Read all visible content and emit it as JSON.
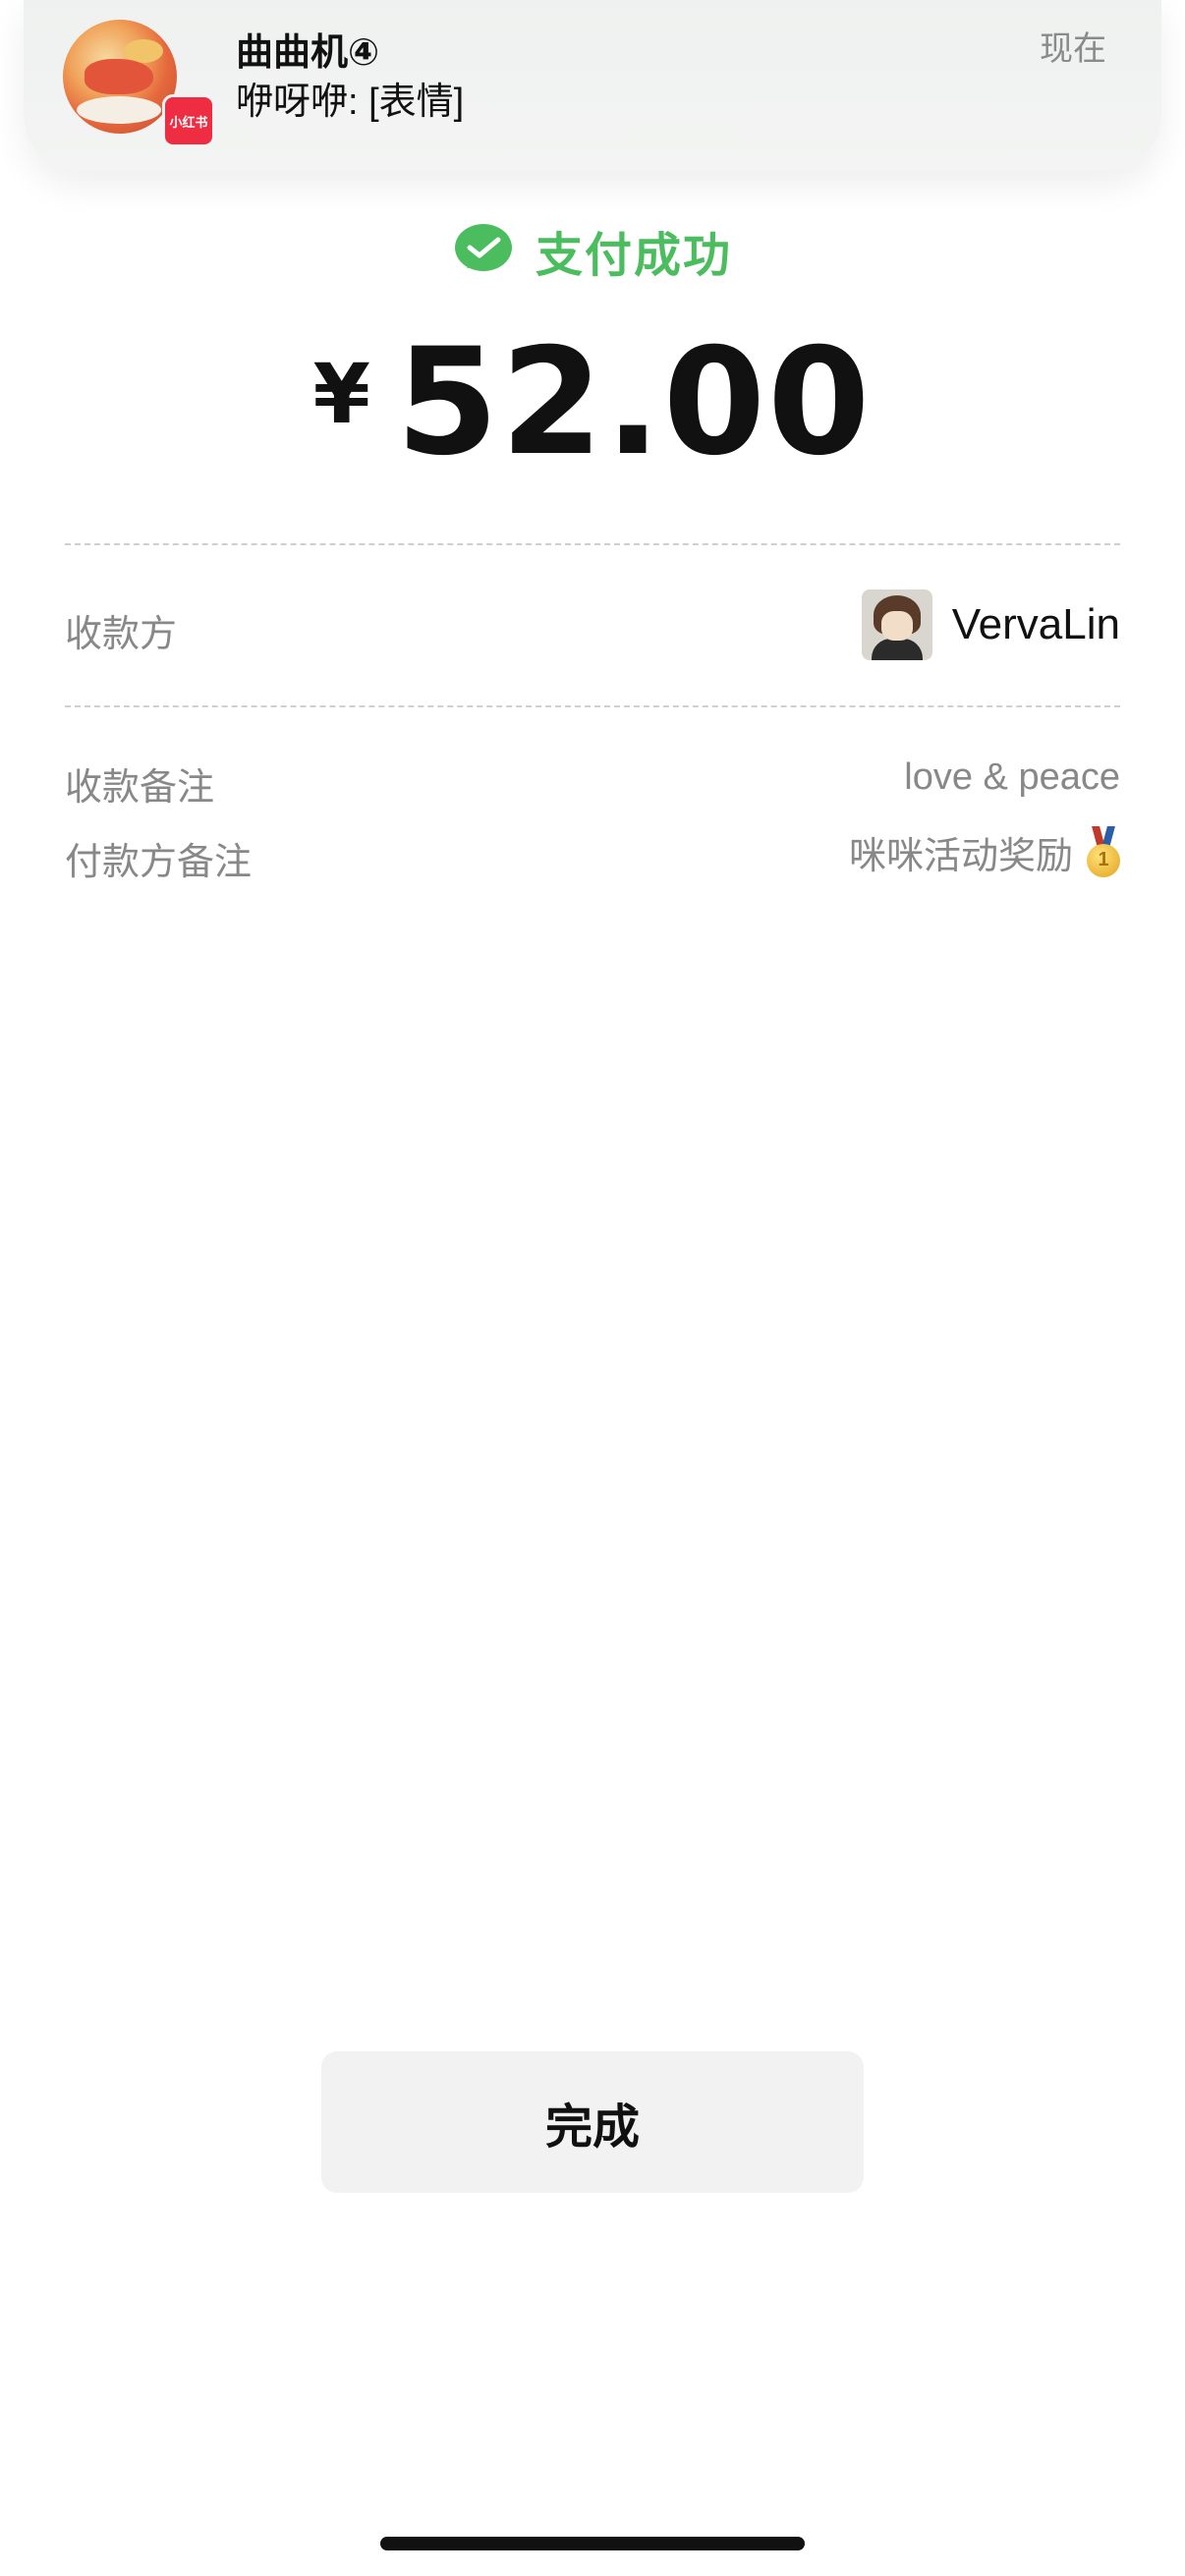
{
  "notification": {
    "title": "曲曲机④",
    "body": "咿呀咿: [表情]",
    "time": "现在",
    "app_badge": "小红书",
    "app_badge_color": "#ee2d43"
  },
  "status": {
    "icon": "wechat-pay-icon",
    "text": "支付成功",
    "color": "#4cbd5f"
  },
  "amount": {
    "currency": "¥",
    "value": "52.00"
  },
  "payee": {
    "label": "收款方",
    "name": "VervaLin"
  },
  "details": {
    "receive_note_label": "收款备注",
    "receive_note_value": "love & peace",
    "payer_note_label": "付款方备注",
    "payer_note_value": "咪咪活动奖励",
    "payer_note_icon": "gold-medal-icon"
  },
  "done_button": {
    "label": "完成"
  }
}
